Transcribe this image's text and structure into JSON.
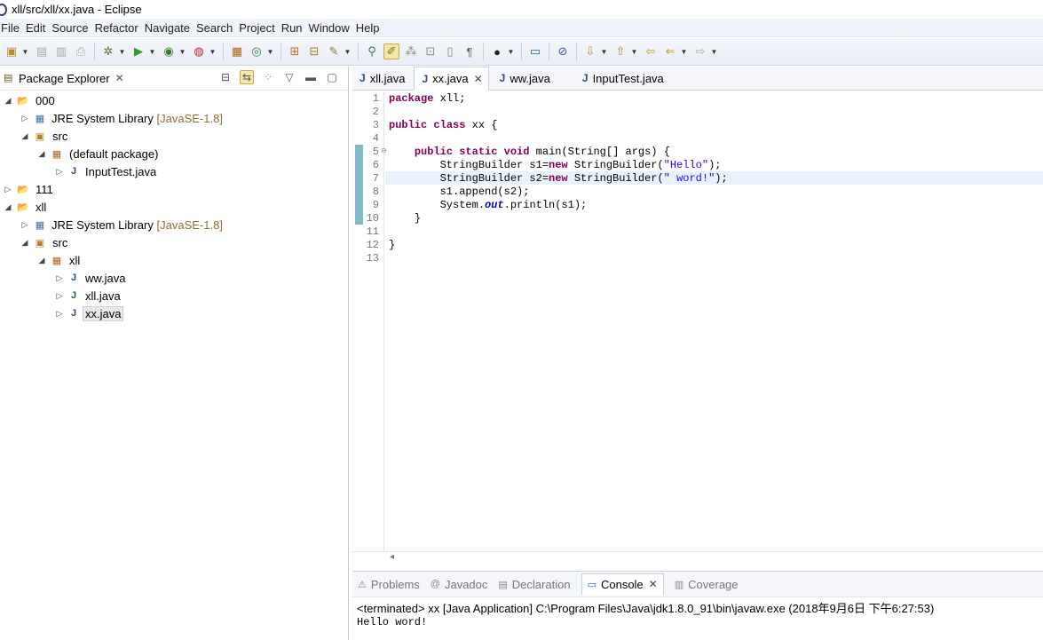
{
  "window": {
    "title": "xll/src/xll/xx.java - Eclipse"
  },
  "menu": [
    "File",
    "Edit",
    "Source",
    "Refactor",
    "Navigate",
    "Search",
    "Project",
    "Run",
    "Window",
    "Help"
  ],
  "explorer": {
    "title": "Package Explorer",
    "tree": [
      {
        "label": "000",
        "icon": "project-icon",
        "state": "expanded"
      },
      {
        "label": "JRE System Library",
        "decoration": "[JavaSE-1.8]",
        "icon": "library-icon",
        "state": "collapsed"
      },
      {
        "label": "src",
        "icon": "source-folder-icon",
        "state": "expanded"
      },
      {
        "label": "(default package)",
        "icon": "package-icon",
        "state": "expanded"
      },
      {
        "label": "InputTest.java",
        "icon": "java-file-icon",
        "state": "collapsed"
      },
      {
        "label": "111",
        "icon": "project-icon",
        "state": "collapsed"
      },
      {
        "label": "xll",
        "icon": "project-icon",
        "state": "expanded"
      },
      {
        "label": "JRE System Library",
        "decoration": "[JavaSE-1.8]",
        "icon": "library-icon",
        "state": "collapsed"
      },
      {
        "label": "src",
        "icon": "source-folder-icon",
        "state": "expanded"
      },
      {
        "label": "xll",
        "icon": "package-icon",
        "state": "expanded"
      },
      {
        "label": "ww.java",
        "icon": "java-file-icon",
        "state": "collapsed"
      },
      {
        "label": "xll.java",
        "icon": "java-file-icon",
        "state": "collapsed"
      },
      {
        "label": "xx.java",
        "icon": "java-file-icon",
        "state": "collapsed",
        "selected": true
      }
    ]
  },
  "editor": {
    "tabs": [
      "xll.java",
      "xx.java",
      "ww.java",
      "InputTest.java"
    ],
    "active_tab": "xx.java",
    "line_numbers": [
      "1",
      "2",
      "3",
      "4",
      "5",
      "6",
      "7",
      "8",
      "9",
      "10",
      "11",
      "12",
      "13"
    ],
    "code": {
      "l1_kw": "package",
      "l1_rest": " xll;",
      "l3_kw1": "public",
      "l3_kw2": "class",
      "l3_rest": " xx {",
      "l5_kw1": "public",
      "l5_kw2": "static",
      "l5_kw3": "void",
      "l5_rest": " main(String[] args) {",
      "l6_a": "StringBuilder s1=",
      "l6_kw": "new",
      "l6_b": " StringBuilder(",
      "l6_str": "\"Hello\"",
      "l6_c": ");",
      "l7_a": "StringBuilder s2=",
      "l7_kw": "new",
      "l7_b": " StringBuilder(",
      "l7_str": "\" word!\"",
      "l7_c": ");",
      "l8": "s1.append(s2);",
      "l9_a": "System.",
      "l9_fld": "out",
      "l9_b": ".println(s1);",
      "l10": "}",
      "l12": "}"
    }
  },
  "console": {
    "tabs": [
      "Problems",
      "Javadoc",
      "Declaration",
      "Console",
      "Coverage"
    ],
    "active_tab": "Console",
    "terminated": "<terminated> xx [Java Application] C:\\Program Files\\Java\\jdk1.8.0_91\\bin\\javaw.exe (2018年9月6日 下午6:27:53)",
    "output": "Hello word!"
  }
}
